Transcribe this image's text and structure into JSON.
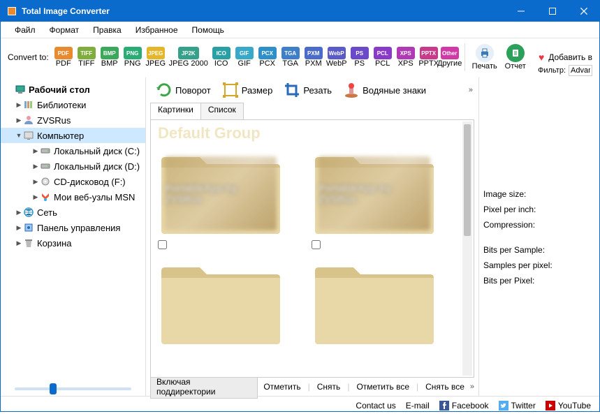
{
  "window": {
    "title": "Total Image Converter"
  },
  "menu": [
    "Файл",
    "Формат",
    "Правка",
    "Избранное",
    "Помощь"
  ],
  "convert": {
    "label": "Convert to:",
    "formats": [
      {
        "id": "PDF",
        "color": "#e98a2e"
      },
      {
        "id": "TIFF",
        "color": "#7fae3d"
      },
      {
        "id": "BMP",
        "color": "#3ca85b"
      },
      {
        "id": "PNG",
        "color": "#2aad74"
      },
      {
        "id": "JPEG",
        "color": "#e6b62a"
      },
      {
        "id": "JPEG 2000",
        "badge": "JP2K",
        "color": "#36a18b",
        "wide": true
      },
      {
        "id": "ICO",
        "color": "#2aa0a5"
      },
      {
        "id": "GIF",
        "color": "#39a9c9"
      },
      {
        "id": "PCX",
        "color": "#2f8fc9"
      },
      {
        "id": "TGA",
        "color": "#3f7ec9"
      },
      {
        "id": "PXM",
        "color": "#4a6bc9"
      },
      {
        "id": "WebP",
        "color": "#5a5ac9"
      },
      {
        "id": "PS",
        "color": "#6a4ac9"
      },
      {
        "id": "PCL",
        "color": "#8a3ac9"
      },
      {
        "id": "XPS",
        "color": "#b03ab6"
      },
      {
        "id": "PPTX",
        "color": "#c93a8a"
      }
    ],
    "other": "Другие",
    "other_color": "#d13aa6",
    "print": "Печать",
    "report": "Отчет",
    "favorite": "Добавить в",
    "filter": "Фильтр:",
    "filter_value": "Advar"
  },
  "tree": [
    {
      "label": "Рабочий стол",
      "icon": "desktop",
      "lvl": 0,
      "bold": true
    },
    {
      "label": "Библиотеки",
      "icon": "libs",
      "lvl": 1,
      "arrow": "▶"
    },
    {
      "label": "ZVSRus",
      "icon": "user",
      "lvl": 1,
      "arrow": "▶"
    },
    {
      "label": "Компьютер",
      "icon": "pc",
      "lvl": 1,
      "arrow": "▼",
      "selected": true
    },
    {
      "label": "Локальный диск (C:)",
      "icon": "drive",
      "lvl": 2,
      "arrow": "▶"
    },
    {
      "label": "Локальный диск (D:)",
      "icon": "drive",
      "lvl": 2,
      "arrow": "▶"
    },
    {
      "label": "CD-дисковод (F:)",
      "icon": "cd",
      "lvl": 2,
      "arrow": "▶"
    },
    {
      "label": "Мои веб-узлы MSN",
      "icon": "msn",
      "lvl": 2,
      "arrow": "▶"
    },
    {
      "label": "Сеть",
      "icon": "net",
      "lvl": 1,
      "arrow": "▶"
    },
    {
      "label": "Панель управления",
      "icon": "cp",
      "lvl": 1,
      "arrow": "▶"
    },
    {
      "label": "Корзина",
      "icon": "trash",
      "lvl": 1,
      "arrow": "▶"
    }
  ],
  "edit_toolbar": {
    "rotate": "Поворот",
    "resize": "Размер",
    "crop": "Резать",
    "watermark": "Водяные знаки"
  },
  "tabs": [
    "Картинки",
    "Список"
  ],
  "thumbs": {
    "group_title": "Default Group",
    "blur_text": "PortableApp by ZVSRus"
  },
  "bottom_actions": {
    "include_sub": "Включая поддиректории",
    "check": "Отметить",
    "uncheck": "Снять",
    "check_all": "Отметить все",
    "uncheck_all": "Снять все"
  },
  "info": {
    "image_size": "Image size:",
    "ppi": "Pixel per inch:",
    "compression": "Compression:",
    "bps": "Bits per Sample:",
    "spp": "Samples per pixel:",
    "bpp": "Bits per Pixel:"
  },
  "status": {
    "contact": "Contact us",
    "email": "E-mail",
    "facebook": "Facebook",
    "twitter": "Twitter",
    "youtube": "YouTube"
  }
}
